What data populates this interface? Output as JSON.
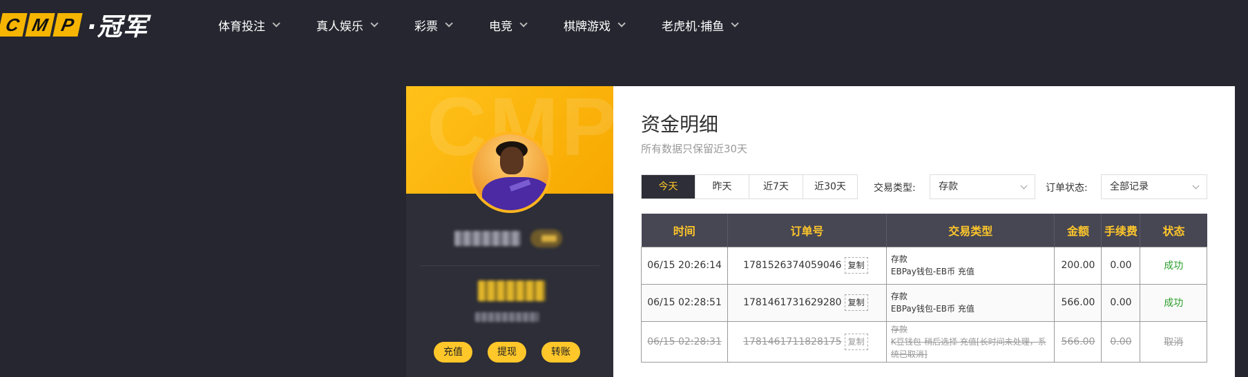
{
  "header": {
    "logo_letters": [
      "C",
      "M",
      "P"
    ],
    "logo_text": "·冠军",
    "nav": [
      {
        "label": "体育投注"
      },
      {
        "label": "真人娱乐"
      },
      {
        "label": "彩票"
      },
      {
        "label": "电竞"
      },
      {
        "label": "棋牌游戏"
      },
      {
        "label": "老虎机·捕鱼"
      }
    ]
  },
  "profile": {
    "banner_watermark": "CMP",
    "buttons": {
      "deposit": "充值",
      "withdraw": "提现",
      "transfer": "转账"
    }
  },
  "main": {
    "title": "资金明细",
    "subtitle": "所有数据只保留近30天",
    "range_tabs": [
      {
        "label": "今天",
        "active": true
      },
      {
        "label": "昨天",
        "active": false
      },
      {
        "label": "近7天",
        "active": false
      },
      {
        "label": "近30天",
        "active": false
      }
    ],
    "filters": {
      "type_label": "交易类型:",
      "type_value": "存款",
      "status_label": "订单状态:",
      "status_value": "全部记录"
    },
    "table": {
      "columns": [
        "时间",
        "订单号",
        "交易类型",
        "金额",
        "手续费",
        "状态"
      ],
      "copy_label": "复制",
      "rows": [
        {
          "time": "06/15 20:26:14",
          "order": "1781526374059046",
          "type": "存款",
          "type_detail": "EBPay钱包-EB币 充值",
          "amount": "200.00",
          "fee": "0.00",
          "status": "成功",
          "state": "success"
        },
        {
          "time": "06/15 02:28:51",
          "order": "1781461731629280",
          "type": "存款",
          "type_detail": "EBPay钱包-EB币 充值",
          "amount": "566.00",
          "fee": "0.00",
          "status": "成功",
          "state": "success"
        },
        {
          "time": "06/15 02:28:31",
          "order": "1781461711828175",
          "type": "存款",
          "type_detail": "K豆钱包-稍后选择 充值[长时间未处理，系统已取消]",
          "amount": "566.00",
          "fee": "0.00",
          "status": "取消",
          "state": "cancelled"
        }
      ]
    }
  },
  "colors": {
    "accent": "#ffc72a",
    "background": "#25262f",
    "panel": "#2d2e37",
    "table_header": "#474653",
    "success": "#2a9d2a"
  }
}
